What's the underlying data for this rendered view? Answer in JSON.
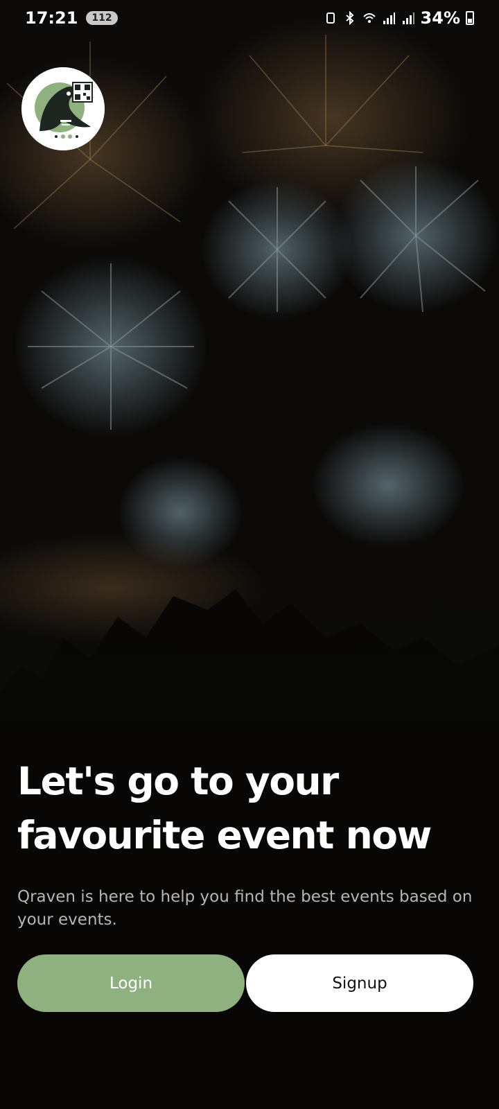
{
  "status_bar": {
    "time": "17:21",
    "notification_count": "112",
    "battery": "34%",
    "icons": [
      "auto-rotate-icon",
      "bluetooth-icon",
      "wifi-icon",
      "signal-icon",
      "signal-icon",
      "battery-icon"
    ]
  },
  "brand": {
    "logo_icon": "raven-qr-logo-icon",
    "logo_colors": {
      "green": "#8fb07f",
      "dark": "#1d2621"
    }
  },
  "hero": {
    "headline_line1": "Let's go to your",
    "headline_line2": "favourite event now",
    "subtitle": "Qraven is here to help you find the best events based on your events."
  },
  "actions": {
    "login_label": "Login",
    "signup_label": "Signup"
  },
  "colors": {
    "accent": "#8fb07f",
    "signup_bg": "#ffffff",
    "background": "#0a0908"
  }
}
